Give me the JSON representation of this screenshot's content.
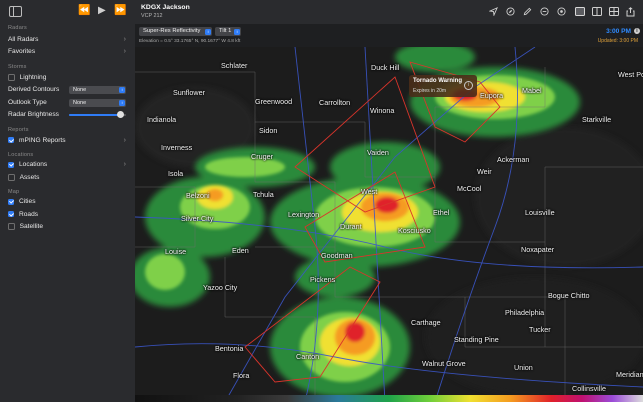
{
  "sidebar": {
    "sections": {
      "radars": "Radars",
      "storms": "Storms",
      "reports": "Reports",
      "locations": "Locations",
      "map": "Map"
    },
    "all_radars": "All Radars",
    "favorites": "Favorites",
    "lightning": {
      "label": "Lightning",
      "checked": false
    },
    "derived_contours": {
      "label": "Derived Contours",
      "value": "None"
    },
    "outlook_type": {
      "label": "Outlook Type",
      "value": "None"
    },
    "radar_brightness": {
      "label": "Radar Brightness",
      "value": 0.9
    },
    "mping": {
      "label": "mPING Reports",
      "checked": true
    },
    "locations_item": {
      "label": "Locations",
      "checked": true
    },
    "assets": {
      "label": "Assets",
      "checked": false
    },
    "cities": {
      "label": "Cities",
      "checked": true
    },
    "roads": {
      "label": "Roads",
      "checked": true
    },
    "satellite": {
      "label": "Satellite",
      "checked": false
    }
  },
  "topbar": {
    "station_code": "KDGX",
    "station_name": "Jackson",
    "vcp": "VCP 212",
    "icons": [
      "location-arrow-icon",
      "compass-icon",
      "pencil-icon",
      "timer-icon",
      "settings-icon",
      "single-pane-icon",
      "dual-pane-icon",
      "quad-pane-icon",
      "share-icon"
    ]
  },
  "subbar": {
    "product": "Super-Res Reflectivity",
    "tilt": "Tilt 1",
    "elevation": "Elevation = 0.5°   33.1765° N, 90.1677° W 4.8 kft",
    "time": "3:00 PM",
    "updated": "Updated: 3:00 PM"
  },
  "warning": {
    "title": "Tornado Warning",
    "subtitle": "Expires in 20m"
  },
  "cities": [
    "Schlater",
    "Duck Hill",
    "West Point",
    "Sunflower",
    "Greenwood",
    "Carrollton",
    "Winona",
    "Eupora",
    "Mabel",
    "Indianola",
    "Sidon",
    "Starkville",
    "Inverness",
    "Cruger",
    "Vaiden",
    "Ackerman",
    "Isola",
    "Weir",
    "Tchula",
    "Belzoni",
    "West",
    "McCool",
    "Lexington",
    "Ethel",
    "Louisville",
    "Silver City",
    "Durant",
    "Kosciusko",
    "Louise",
    "Eden",
    "Goodman",
    "Noxapater",
    "Yazoo City",
    "Pickens",
    "Bogue Chitto",
    "Philadelphia",
    "Carthage",
    "Tucker",
    "Bentonia",
    "Standing Pine",
    "Canton",
    "Walnut Grove",
    "Flora",
    "Union",
    "Meridian",
    "Collinsville"
  ],
  "colors": {
    "accent": "#2f7cf6",
    "warning_polygon": "#d9342b",
    "sidebar_bg": "#2a2b2e",
    "updated": "#e0a23a"
  }
}
